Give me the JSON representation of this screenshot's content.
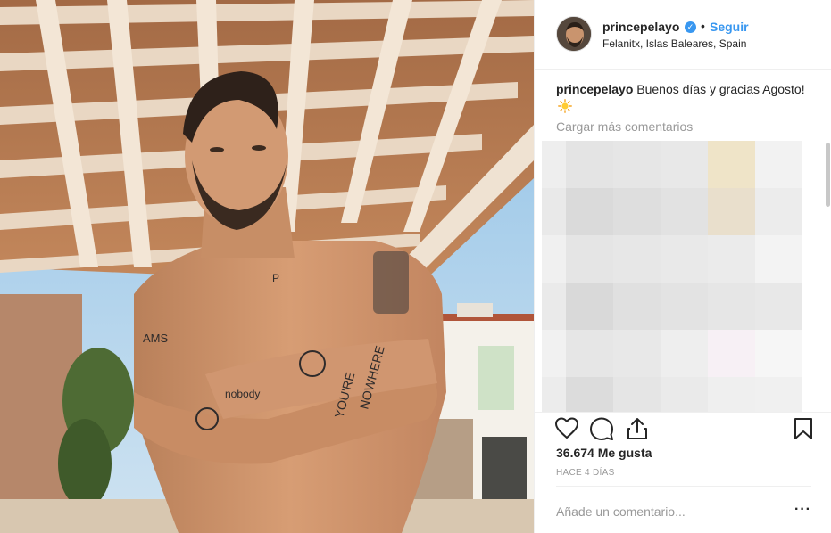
{
  "post": {
    "username": "princepelayo",
    "verified": true,
    "separator": "•",
    "follow_label": "Seguir",
    "location": "Felanitx, Islas Baleares, Spain",
    "caption_user": "princepelayo",
    "caption_text": "Buenos días y gracias Agosto!",
    "load_more": "Cargar más comentarios",
    "likes": "36.674 Me gusta",
    "time": "HACE 4 DÍAS",
    "comment_placeholder": "Añade un comentario...",
    "more_label": "···"
  },
  "colors": {
    "link_blue": "#3897f0",
    "muted_gray": "#999999",
    "text_dark": "#262626",
    "border": "#efefef"
  },
  "icons": [
    "heart-icon",
    "comment-icon",
    "share-icon",
    "bookmark-icon",
    "verified-badge-icon",
    "sun-emoji-icon"
  ]
}
